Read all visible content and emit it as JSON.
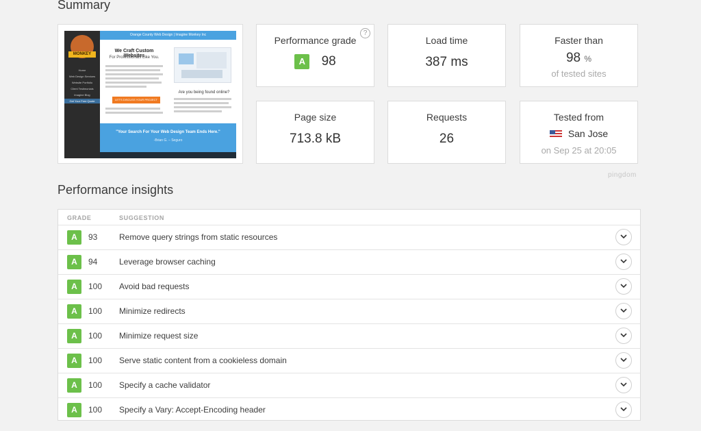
{
  "summary": {
    "title": "Summary",
    "thumbnail": {
      "topbar": "Orange County Web Design | Imagine Monkey Inc",
      "heading": "We Craft Custom Websites",
      "subheading": "For Professionals Like You.",
      "logo_text": "MONKEY",
      "nav_items": [
        "Home",
        "Web Design Services",
        "Website Portfolio",
        "Client Testimonials",
        "Imagine Blog"
      ],
      "side_button": "Get Your Free Quote",
      "cta": "LET'S DISCUSS YOUR PROJECT",
      "question": "Are you being found online?",
      "quote": "\"Your Search For Your Web Design Team Ends Here.\"",
      "quote_author": "-Brian G. – Seguro"
    },
    "cards": {
      "performance_grade": {
        "label": "Performance grade",
        "grade": "A",
        "value": "98",
        "help_icon": "question-circle-icon"
      },
      "load_time": {
        "label": "Load time",
        "value": "387 ms"
      },
      "faster_than": {
        "label": "Faster than",
        "value": "98",
        "unit": "%",
        "sub": "of tested sites"
      },
      "page_size": {
        "label": "Page size",
        "value": "713.8 kB"
      },
      "requests": {
        "label": "Requests",
        "value": "26"
      },
      "tested_from": {
        "label": "Tested from",
        "location": "San Jose",
        "date": "on Sep 25 at 20:05",
        "flag_icon": "us-flag-icon"
      }
    },
    "brand": "pingdom"
  },
  "insights": {
    "title": "Performance insights",
    "columns": {
      "grade": "GRADE",
      "suggestion": "SUGGESTION"
    },
    "rows": [
      {
        "grade": "A",
        "score": "93",
        "suggestion": "Remove query strings from static resources"
      },
      {
        "grade": "A",
        "score": "94",
        "suggestion": "Leverage browser caching"
      },
      {
        "grade": "A",
        "score": "100",
        "suggestion": "Avoid bad requests"
      },
      {
        "grade": "A",
        "score": "100",
        "suggestion": "Minimize redirects"
      },
      {
        "grade": "A",
        "score": "100",
        "suggestion": "Minimize request size"
      },
      {
        "grade": "A",
        "score": "100",
        "suggestion": "Serve static content from a cookieless domain"
      },
      {
        "grade": "A",
        "score": "100",
        "suggestion": "Specify a cache validator"
      },
      {
        "grade": "A",
        "score": "100",
        "suggestion": "Specify a Vary: Accept-Encoding header"
      }
    ]
  },
  "colors": {
    "grade_a": "#6cc04a",
    "page_bg": "#f2f2f2",
    "card_border": "#dcdcdc",
    "muted_text": "#a9a9a9"
  }
}
